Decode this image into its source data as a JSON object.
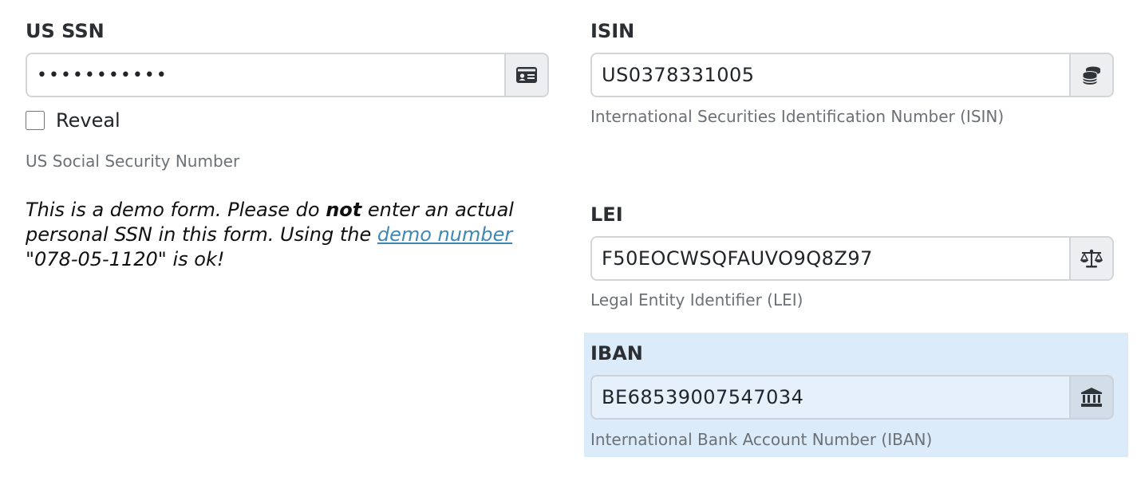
{
  "ssn": {
    "label": "US SSN",
    "value": "•••••••••••",
    "addon_icon": "id-card-icon",
    "reveal_label": "Reveal",
    "reveal_checked": false,
    "help": "US Social Security Number"
  },
  "notice": {
    "part1": "This is a demo form. Please do ",
    "emphasis": "not",
    "part2": " enter an actual personal SSN in this form. Using the ",
    "link_text": "demo number",
    "part3": " \"078-05-1120\" is ok!"
  },
  "isin": {
    "label": "ISIN",
    "value": "US0378331005",
    "addon_icon": "coins-icon",
    "help": "International Securities Identification Number (ISIN)"
  },
  "lei": {
    "label": "LEI",
    "value": "F50EOCWSQFAUVO9Q8Z97",
    "addon_icon": "balance-scale-icon",
    "help": "Legal Entity Identifier (LEI)"
  },
  "iban": {
    "label": "IBAN",
    "value": "BE68539007547034",
    "addon_icon": "bank-icon",
    "help": "International Bank Account Number (IBAN)",
    "highlight_color": "#dcebfa"
  },
  "colors": {
    "link": "#3d88b5",
    "help_text": "#6b7176",
    "addon_bg": "#eceef0",
    "border": "#d3d6d9"
  }
}
